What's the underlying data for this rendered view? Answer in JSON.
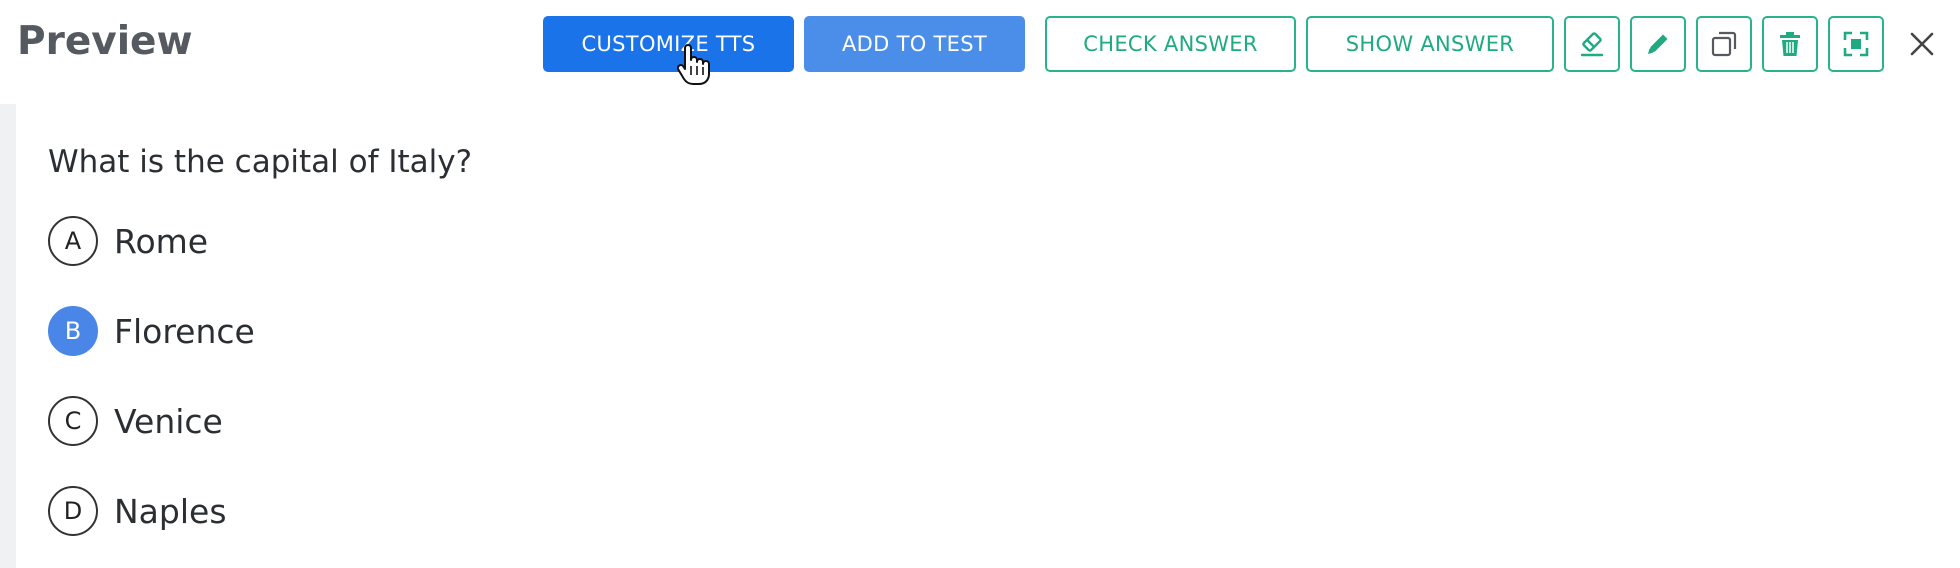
{
  "header": {
    "title": "Preview",
    "buttons": {
      "customize_tts": "CUSTOMIZE TTS",
      "add_to_test": "ADD TO TEST",
      "check_answer": "CHECK ANSWER",
      "show_answer": "SHOW ANSWER"
    },
    "icons": [
      "eraser-icon",
      "pencil-icon",
      "copy-icon",
      "trash-icon",
      "fullscreen-icon",
      "close-icon"
    ]
  },
  "question": {
    "text": "What is the capital of Italy?",
    "options": [
      {
        "letter": "A",
        "label": "Rome"
      },
      {
        "letter": "B",
        "label": "Florence"
      },
      {
        "letter": "C",
        "label": "Venice"
      },
      {
        "letter": "D",
        "label": "Naples"
      }
    ],
    "selected": "B"
  },
  "colors": {
    "primary_blue": "#1a73e8",
    "secondary_blue": "#4a8ee9",
    "accent_green": "#2ab38a",
    "selected_option": "#4a86e8"
  }
}
